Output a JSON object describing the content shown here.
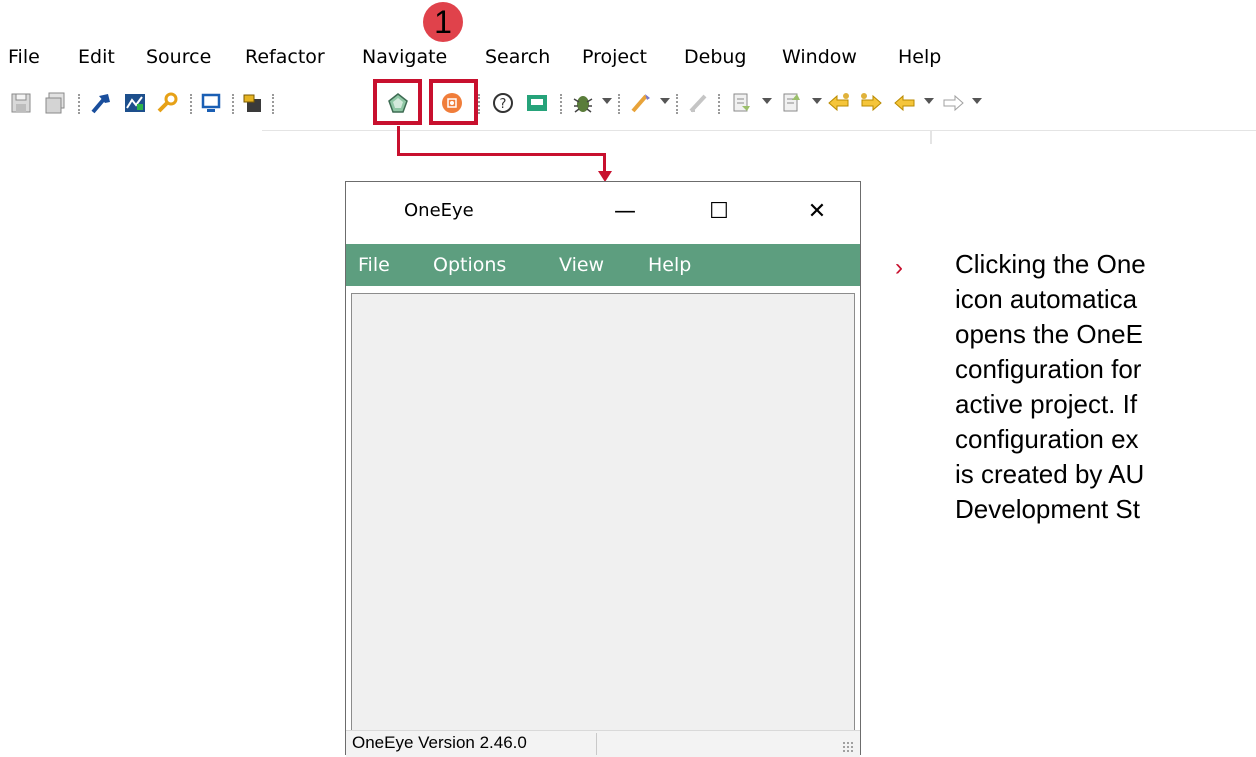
{
  "menubar": {
    "items": [
      "File",
      "Edit",
      "Source",
      "Refactor",
      "Navigate",
      "Search",
      "Project",
      "Debug",
      "Window",
      "Help"
    ]
  },
  "annotation": {
    "badge": "1"
  },
  "toolbar": {
    "icons": [
      "save-icon",
      "save-all-icon",
      "build-icon",
      "analyzer-icon",
      "settings-wrench-icon",
      "device-icon",
      "chip-icon",
      "oneeye-icon",
      "oneeye-config-icon",
      "help-icon",
      "console-icon",
      "debug-icon",
      "tool-icon",
      "edit-icon",
      "next-annotation-icon",
      "prev-annotation-icon",
      "last-edit-icon",
      "back-icon",
      "forward-icon"
    ]
  },
  "window": {
    "title": "OneEye",
    "controls": {
      "minimize": "—",
      "maximize": "☐",
      "close": "✕"
    },
    "menu": [
      "File",
      "Options",
      "View",
      "Help"
    ],
    "status": "OneEye Version 2.46.0",
    "menu_color": "#5d9e7f"
  },
  "description": {
    "bullet": "›",
    "lines": [
      "Clicking the One",
      "icon automatica",
      "opens the OneE",
      "configuration for",
      "active project. If",
      "configuration ex",
      "is created by AU",
      "Development St"
    ]
  },
  "colors": {
    "accent": "#c8102e",
    "badge": "#e0424b"
  }
}
